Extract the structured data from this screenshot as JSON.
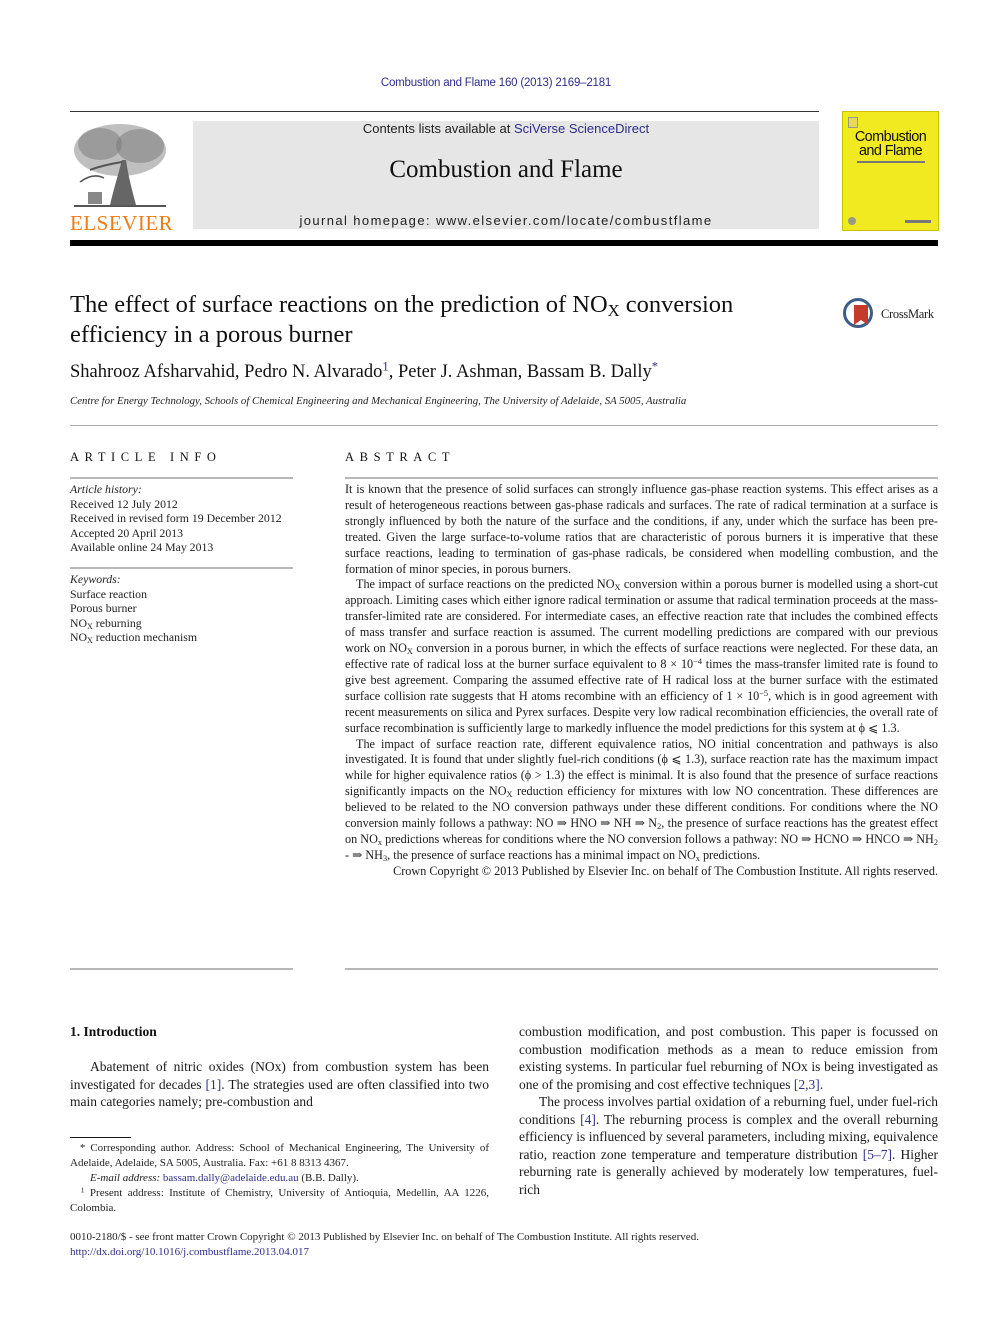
{
  "header": {
    "journal_ref": "Combustion and Flame 160 (2013) 2169–2181",
    "publisher_name": "ELSEVIER",
    "contents_prefix": "Contents lists available at ",
    "contents_link": "SciVerse ScienceDirect",
    "journal_title": "Combustion and Flame",
    "homepage": "journal homepage: www.elsevier.com/locate/combustflame",
    "cover_title_1": "Combustion",
    "cover_title_2": "and Flame"
  },
  "article": {
    "title_part1": "The effect of surface reactions on the prediction of NO",
    "title_sub": "X",
    "title_part2": " conversion efficiency in a porous burner",
    "crossmark_label": "CrossMark",
    "authors": [
      {
        "name": "Shahrooz Afsharvahid",
        "mark": ""
      },
      {
        "name": "Pedro N. Alvarado",
        "mark": "1"
      },
      {
        "name": "Peter J. Ashman",
        "mark": ""
      },
      {
        "name": "Bassam B. Dally",
        "mark": "*"
      }
    ],
    "affiliation": "Centre for Energy Technology, Schools of Chemical Engineering and Mechanical Engineering, The University of Adelaide, SA 5005, Australia"
  },
  "article_info": {
    "heading": "ARTICLE INFO",
    "history_label": "Article history:",
    "history": [
      "Received 12 July 2012",
      "Received in revised form 19 December 2012",
      "Accepted 20 April 2013",
      "Available online 24 May 2013"
    ],
    "keywords_label": "Keywords:",
    "keywords": [
      "Surface reaction",
      "Porous burner",
      "reburning",
      "reduction mechanism"
    ],
    "keyword_prefix_nox": "NO",
    "keyword_prefix_sub": "X"
  },
  "abstract": {
    "heading": "ABSTRACT",
    "p1": "It is known that the presence of solid surfaces can strongly influence gas-phase reaction systems. This effect arises as a result of heterogeneous reactions between gas-phase radicals and surfaces. The rate of radical termination at a surface is strongly influenced by both the nature of the surface and the conditions, if any, under which the surface has been pre-treated. Given the large surface-to-volume ratios that are characteristic of porous burners it is imperative that these surface reactions, leading to termination of gas-phase radicals, be considered when modelling combustion, and the formation of minor species, in porous burners.",
    "p2a": "The impact of surface reactions on the predicted NO",
    "p2b": " conversion within a porous burner is modelled using a short-cut approach. Limiting cases which either ignore radical termination or assume that radical termination proceeds at the mass-transfer-limited rate are considered. For intermediate cases, an effective reaction rate that includes the combined effects of mass transfer and surface reaction is assumed. The current modelling predictions are compared with our previous work on NO",
    "p2c": " conversion in a porous burner, in which the effects of surface reactions were neglected. For these data, an effective rate of radical loss at the burner surface equivalent to 8 × 10",
    "p2_exp1": "−4",
    "p2d": " times the mass-transfer limited rate is found to give best agreement. Comparing the assumed effective rate of H radical loss at the burner surface with the estimated surface collision rate suggests that H atoms recombine with an efficiency of 1 × 10",
    "p2_exp2": "−5",
    "p2e": ", which is in good agreement with recent measurements on silica and Pyrex surfaces. Despite very low radical recombination efficiencies, the overall rate of surface recombination is sufficiently large to markedly influence the model predictions for this system at ϕ ⩽ 1.3.",
    "p3a": "The impact of surface reaction rate, different equivalence ratios, NO initial concentration and pathways is also investigated. It is found that under slightly fuel-rich conditions (ϕ ⩽ 1.3), surface reaction rate has the maximum impact while for higher equivalence ratios (ϕ > 1.3) the effect is minimal. It is also found that the presence of surface reactions significantly impacts on the NO",
    "p3b": " reduction efficiency for mixtures with low NO concentration. These differences are believed to be related to the NO conversion pathways under these different conditions. For conditions where the NO conversion mainly follows a pathway: NO ⇒ HNO ⇒ NH ⇒ N",
    "p3c": ", the presence of surface reactions has the greatest effect on NO",
    "p3d": " predictions whereas for conditions where the NO conversion follows a pathway: NO ⇒ HCNO ⇒ HNCO ⇒ NH",
    "p3e": " - ⇒ NH",
    "p3f": ", the presence of surface reactions has a minimal impact on NO",
    "p3g": " predictions.",
    "sub_X": "X",
    "sub_x": "x",
    "sub_2": "2",
    "sub_3": "3",
    "copyright": "Crown Copyright © 2013 Published by Elsevier Inc. on behalf of The Combustion Institute. All rights reserved."
  },
  "introduction": {
    "heading": "1. Introduction",
    "left_p1a": "Abatement of nitric oxides (NOx) from combustion system has been investigated for decades ",
    "ref1": "[1]",
    "left_p1b": ". The strategies used are often classified into two main categories namely; pre-combustion and",
    "right_p1a": "combustion modification, and post combustion. This paper is focussed on combustion modification methods as a mean to reduce emission from existing systems. In particular fuel reburning of NOx is being investigated as one of the promising and cost effective techniques ",
    "ref23": "[2,3]",
    "right_p2a": "The process involves partial oxidation of a reburning fuel, under fuel-rich conditions ",
    "ref4": "[4]",
    "right_p2b": ". The reburning process is complex and the overall reburning efficiency is influenced by several parameters, including mixing, equivalence ratio, reaction zone temperature and temperature distribution ",
    "ref57": "[5–7]",
    "right_p2c": ". Higher reburning rate is generally achieved by moderately low temperatures, fuel-rich"
  },
  "footnotes": {
    "corr_mark": "*",
    "corr_text": " Corresponding author. Address: School of Mechanical Engineering, The University of Adelaide, Adelaide, SA 5005, Australia. Fax: +61 8 8313 4367.",
    "email_label": "E-mail address: ",
    "email": "bassam.dally@adelaide.edu.au",
    "email_suffix": " (B.B. Dally).",
    "fn1_mark": "1",
    "fn1_text": " Present address: Institute of Chemistry, University of Antioquia, Medellin, AA 1226, Colombia."
  },
  "footer": {
    "issn_line": "0010-2180/$ - see front matter Crown Copyright © 2013 Published by Elsevier Inc. on behalf of The Combustion Institute. All rights reserved.",
    "doi": "http://dx.doi.org/10.1016/j.combustflame.2013.04.017"
  }
}
